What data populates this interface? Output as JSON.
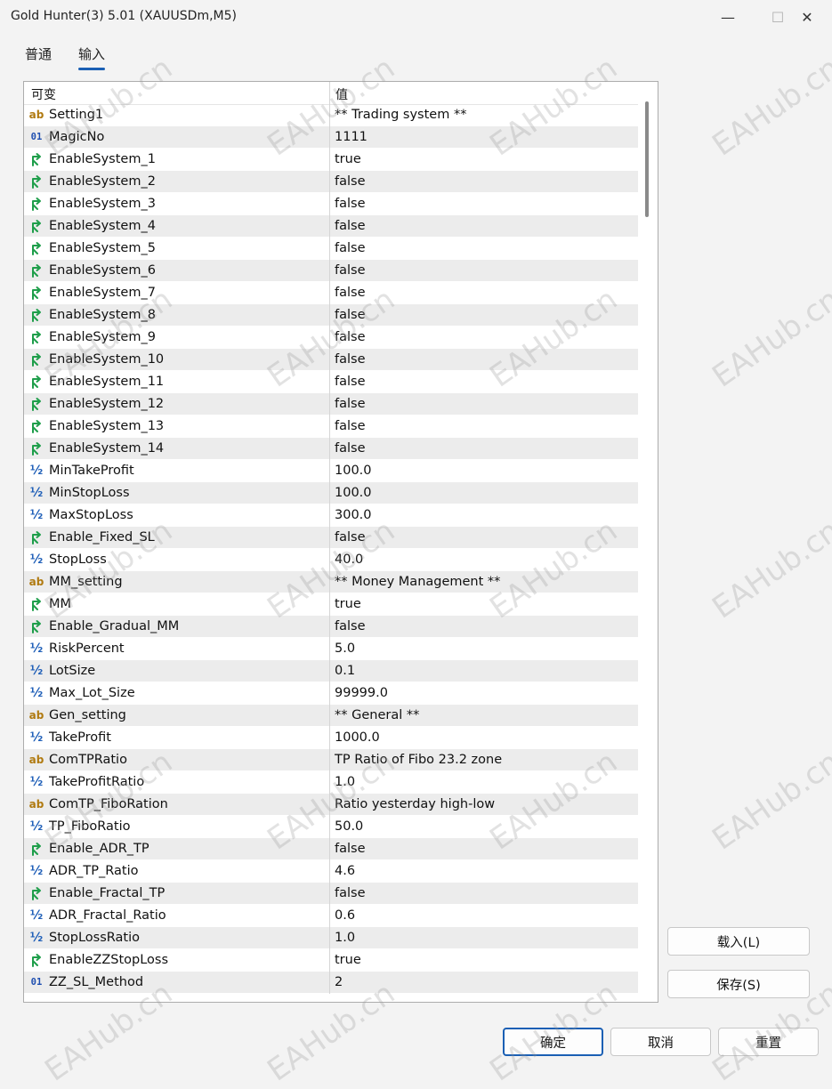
{
  "window": {
    "title": "Gold Hunter(3) 5.01 (XAUUSDm,M5)",
    "minimize_glyph": "—",
    "maximize_glyph": "☐",
    "close_glyph": "✕"
  },
  "tabs": [
    {
      "label": "普通",
      "active": false
    },
    {
      "label": "输入",
      "active": true
    }
  ],
  "grid": {
    "col_name": "可变",
    "col_value": "值",
    "rows": [
      {
        "icon": "string-icon",
        "name": "Setting1",
        "value": "** Trading system **"
      },
      {
        "icon": "integer-icon",
        "name": "MagicNo",
        "value": "1111"
      },
      {
        "icon": "bool-icon",
        "name": "EnableSystem_1",
        "value": "true"
      },
      {
        "icon": "bool-icon",
        "name": "EnableSystem_2",
        "value": "false"
      },
      {
        "icon": "bool-icon",
        "name": "EnableSystem_3",
        "value": "false"
      },
      {
        "icon": "bool-icon",
        "name": "EnableSystem_4",
        "value": "false"
      },
      {
        "icon": "bool-icon",
        "name": "EnableSystem_5",
        "value": "false"
      },
      {
        "icon": "bool-icon",
        "name": "EnableSystem_6",
        "value": "false"
      },
      {
        "icon": "bool-icon",
        "name": "EnableSystem_7",
        "value": "false"
      },
      {
        "icon": "bool-icon",
        "name": "EnableSystem_8",
        "value": "false"
      },
      {
        "icon": "bool-icon",
        "name": "EnableSystem_9",
        "value": "false"
      },
      {
        "icon": "bool-icon",
        "name": "EnableSystem_10",
        "value": "false"
      },
      {
        "icon": "bool-icon",
        "name": "EnableSystem_11",
        "value": "false"
      },
      {
        "icon": "bool-icon",
        "name": "EnableSystem_12",
        "value": "false"
      },
      {
        "icon": "bool-icon",
        "name": "EnableSystem_13",
        "value": "false"
      },
      {
        "icon": "bool-icon",
        "name": "EnableSystem_14",
        "value": "false"
      },
      {
        "icon": "double-icon",
        "name": "MinTakeProfit",
        "value": "100.0"
      },
      {
        "icon": "double-icon",
        "name": "MinStopLoss",
        "value": "100.0"
      },
      {
        "icon": "double-icon",
        "name": "MaxStopLoss",
        "value": "300.0"
      },
      {
        "icon": "bool-icon",
        "name": "Enable_Fixed_SL",
        "value": "false"
      },
      {
        "icon": "double-icon",
        "name": "StopLoss",
        "value": "40.0"
      },
      {
        "icon": "string-icon",
        "name": "MM_setting",
        "value": "** Money Management **"
      },
      {
        "icon": "bool-icon",
        "name": "MM",
        "value": "true"
      },
      {
        "icon": "bool-icon",
        "name": "Enable_Gradual_MM",
        "value": "false"
      },
      {
        "icon": "double-icon",
        "name": "RiskPercent",
        "value": "5.0"
      },
      {
        "icon": "double-icon",
        "name": "LotSize",
        "value": "0.1"
      },
      {
        "icon": "double-icon",
        "name": "Max_Lot_Size",
        "value": "99999.0"
      },
      {
        "icon": "string-icon",
        "name": "Gen_setting",
        "value": "** General **"
      },
      {
        "icon": "double-icon",
        "name": "TakeProfit",
        "value": "1000.0"
      },
      {
        "icon": "string-icon",
        "name": "ComTPRatio",
        "value": "TP Ratio of Fibo 23.2 zone"
      },
      {
        "icon": "double-icon",
        "name": "TakeProfitRatio",
        "value": "1.0"
      },
      {
        "icon": "string-icon",
        "name": "ComTP_FiboRation",
        "value": "Ratio yesterday high-low"
      },
      {
        "icon": "double-icon",
        "name": "TP_FiboRatio",
        "value": "50.0"
      },
      {
        "icon": "bool-icon",
        "name": "Enable_ADR_TP",
        "value": "false"
      },
      {
        "icon": "double-icon",
        "name": "ADR_TP_Ratio",
        "value": "4.6"
      },
      {
        "icon": "bool-icon",
        "name": "Enable_Fractal_TP",
        "value": "false"
      },
      {
        "icon": "double-icon",
        "name": "ADR_Fractal_Ratio",
        "value": "0.6"
      },
      {
        "icon": "double-icon",
        "name": "StopLossRatio",
        "value": "1.0"
      },
      {
        "icon": "bool-icon",
        "name": "EnableZZStopLoss",
        "value": "true"
      },
      {
        "icon": "integer-icon",
        "name": "ZZ_SL_Method",
        "value": "2"
      }
    ]
  },
  "icon_glyphs": {
    "string-icon": "ab",
    "integer-icon": "01",
    "double-icon": "½",
    "bool-icon": ""
  },
  "buttons": {
    "load": "载入(L)",
    "save": "保存(S)",
    "ok": "确定",
    "cancel": "取消",
    "reset": "重置"
  },
  "watermark": "EAHub.cn",
  "colors": {
    "accent": "#1a5fb4",
    "bool_icon": "#1e9e4a",
    "string_icon": "#b07a10",
    "number_icon": "#1f5fb8"
  }
}
